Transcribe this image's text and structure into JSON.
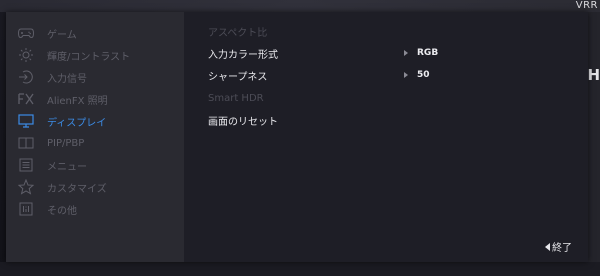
{
  "background": {
    "top_right_text": "VRR",
    "mid_right_text": "H"
  },
  "sidebar": {
    "items": [
      {
        "label": "ゲーム",
        "icon": "gamepad-icon",
        "active": false
      },
      {
        "label": "輝度/コントラスト",
        "icon": "brightness-icon",
        "active": false
      },
      {
        "label": "入力信号",
        "icon": "input-source-icon",
        "active": false
      },
      {
        "label": "AlienFX 照明",
        "icon": "fx-icon",
        "active": false
      },
      {
        "label": "ディスプレイ",
        "icon": "monitor-icon",
        "active": true
      },
      {
        "label": "PIP/PBP",
        "icon": "pip-icon",
        "active": false
      },
      {
        "label": "メニュー",
        "icon": "menu-icon",
        "active": false
      },
      {
        "label": "カスタマイズ",
        "icon": "star-icon",
        "active": false
      },
      {
        "label": "その他",
        "icon": "info-icon",
        "active": false
      }
    ]
  },
  "main": {
    "rows": [
      {
        "label": "アスペクト比",
        "value": "",
        "enabled": false,
        "has_arrow": false
      },
      {
        "label": "入力カラー形式",
        "value": "RGB",
        "enabled": true,
        "has_arrow": true
      },
      {
        "label": "シャープネス",
        "value": "50",
        "enabled": true,
        "has_arrow": true
      },
      {
        "label": "Smart HDR",
        "value": "",
        "enabled": false,
        "has_arrow": false
      },
      {
        "label": "画面のリセット",
        "value": "",
        "enabled": true,
        "has_arrow": false
      }
    ]
  },
  "exit_label": "終了",
  "colors": {
    "accent": "#3c8ce6",
    "inactive_text": "#5f5f69",
    "active_text": "#e8e8ec",
    "disabled_text": "#4c4c56"
  }
}
